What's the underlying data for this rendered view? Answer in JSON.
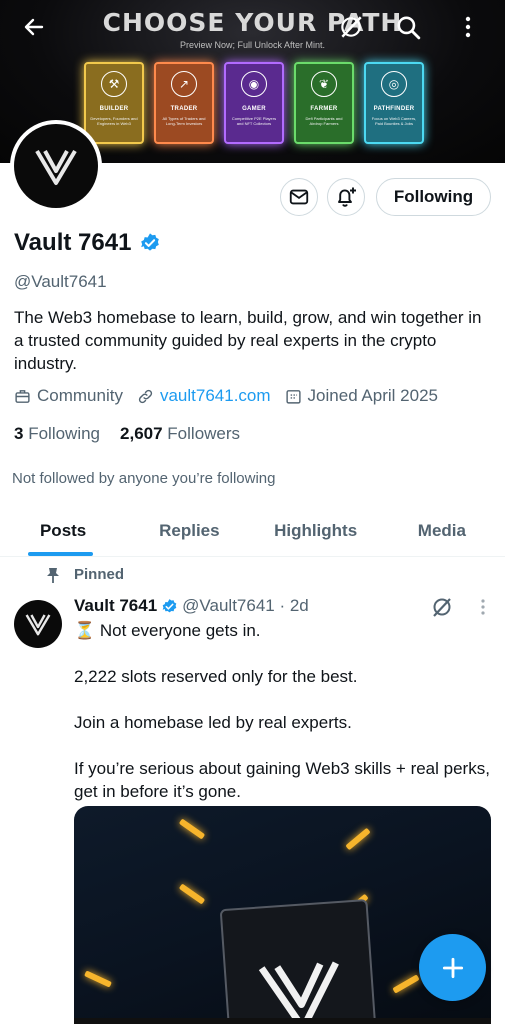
{
  "banner": {
    "title": "CHOOSE YOUR PATH",
    "subtitle": "Preview Now; Full Unlock After Mint.",
    "cards": [
      {
        "name": "BUILDER",
        "desc": "Developers, Founders and Engineers in Web3",
        "color": "#f2c94c",
        "bg": "#8a6d1f"
      },
      {
        "name": "TRADER",
        "desc": "All Types of Traders and Long-Term Investors",
        "color": "#ff8a4c",
        "bg": "#9c4a22"
      },
      {
        "name": "GAMER",
        "desc": "Competitive P2E Players and NFT Collectors",
        "color": "#b26bff",
        "bg": "#5a2a8f"
      },
      {
        "name": "FARMER",
        "desc": "Defi Participants and Airdrop Farmers",
        "color": "#6bdc6b",
        "bg": "#2a6e2a"
      },
      {
        "name": "PATHFINDER",
        "desc": "Focus on Web3 Careers, Paid Bounties & Jobs",
        "color": "#4cd9f2",
        "bg": "#1f6f80"
      }
    ]
  },
  "profile": {
    "name": "Vault 7641",
    "handle": "@Vault7641",
    "bio": "The Web3 homebase to learn, build, grow, and win together in a trusted community guided by real experts in the crypto industry.",
    "category": "Community",
    "website": "vault7641.com",
    "joined": "Joined April 2025",
    "following_count": "3",
    "following_label": "Following",
    "followers_count": "2,607",
    "followers_label": "Followers",
    "not_followed": "Not followed by anyone you’re following",
    "follow_button": "Following"
  },
  "tabs": [
    "Posts",
    "Replies",
    "Highlights",
    "Media"
  ],
  "post": {
    "pinned_label": "Pinned",
    "name": "Vault 7641",
    "handle_time": "@Vault7641 · 2d",
    "text": "⏳ Not everyone gets in.\n\n2,222 slots reserved only for the best.\n\nJoin a homebase led by real experts.\n\nIf you’re serious about gaining Web3 skills + real perks, get in before it’s gone."
  },
  "colors": {
    "accent": "#1d9bf0",
    "secondary_text": "#536471"
  }
}
